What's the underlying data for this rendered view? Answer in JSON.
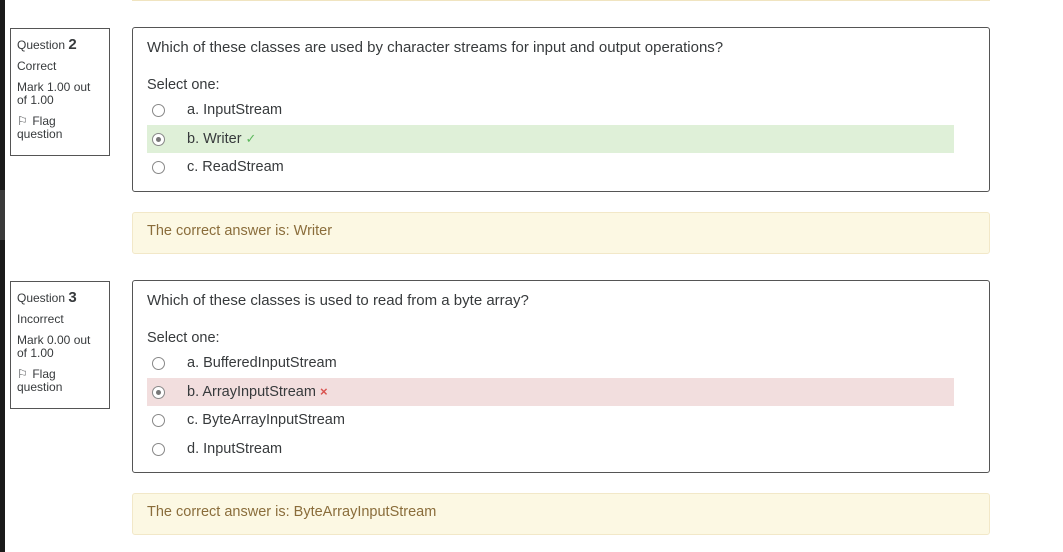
{
  "questions": [
    {
      "label": "Question",
      "number": "2",
      "state": "Correct",
      "grade": "Mark 1.00 out of 1.00",
      "flag_label": "Flag question",
      "text": "Which of these classes are used by character streams for input and output operations?",
      "prompt": "Select one:",
      "options": [
        {
          "label": "a. InputStream",
          "selected": false,
          "status": ""
        },
        {
          "label": "b. Writer",
          "selected": true,
          "status": "correct"
        },
        {
          "label": "c. ReadStream",
          "selected": false,
          "status": ""
        }
      ],
      "feedback": "The correct answer is: Writer"
    },
    {
      "label": "Question",
      "number": "3",
      "state": "Incorrect",
      "grade": "Mark 0.00 out of 1.00",
      "flag_label": "Flag question",
      "text": "Which of these classes is used to read from a byte array?",
      "prompt": "Select one:",
      "options": [
        {
          "label": "a. BufferedInputStream",
          "selected": false,
          "status": ""
        },
        {
          "label": "b. ArrayInputStream",
          "selected": true,
          "status": "incorrect"
        },
        {
          "label": "c. ByteArrayInputStream",
          "selected": false,
          "status": ""
        },
        {
          "label": "d. InputStream",
          "selected": false,
          "status": ""
        }
      ],
      "feedback": "The correct answer is: ByteArrayInputStream"
    }
  ],
  "icons": {
    "flag": "flag-icon",
    "correct": "check-icon",
    "incorrect": "cross-icon"
  },
  "colors": {
    "correct_bg": "#dff0d8",
    "incorrect_bg": "#f2dede",
    "feedback_bg": "#fcf8e3",
    "check": "#5cb85c",
    "cross": "#d9534f"
  }
}
